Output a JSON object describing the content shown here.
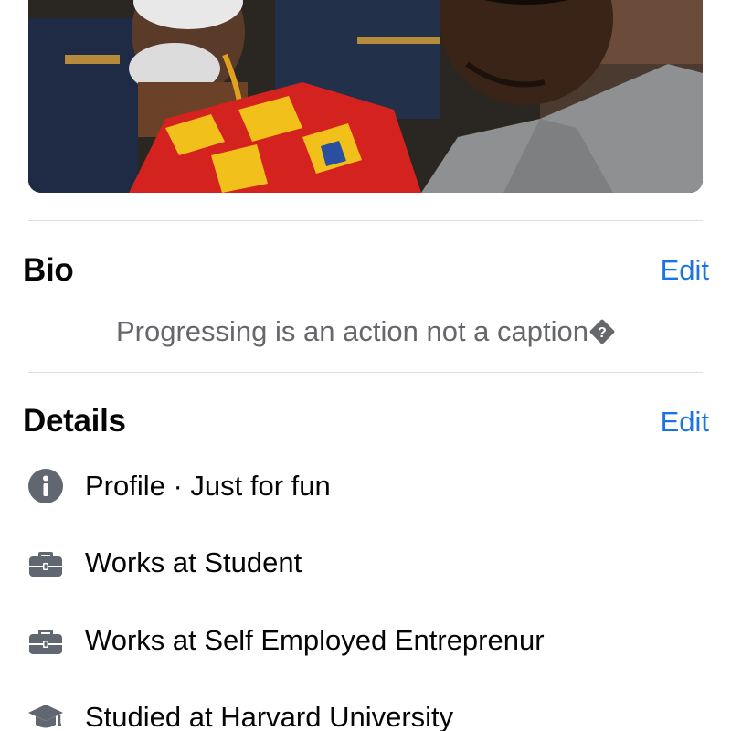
{
  "cover": {
    "description_icon": "cover-photo"
  },
  "bio": {
    "title": "Bio",
    "edit_label": "Edit",
    "text": "Progressing is an action not a caption"
  },
  "details": {
    "title": "Details",
    "edit_label": "Edit",
    "items": [
      {
        "icon": "info-icon",
        "label": "Profile · Just for fun"
      },
      {
        "icon": "briefcase-icon",
        "label": "Works at Student"
      },
      {
        "icon": "briefcase-icon",
        "label": "Works at Self Employed Entreprenur"
      },
      {
        "icon": "graduation-cap-icon",
        "label": "Studied at Harvard University"
      }
    ]
  },
  "colors": {
    "link": "#1b74e4",
    "secondary_text": "#65676b",
    "icon_gray": "#606770"
  }
}
